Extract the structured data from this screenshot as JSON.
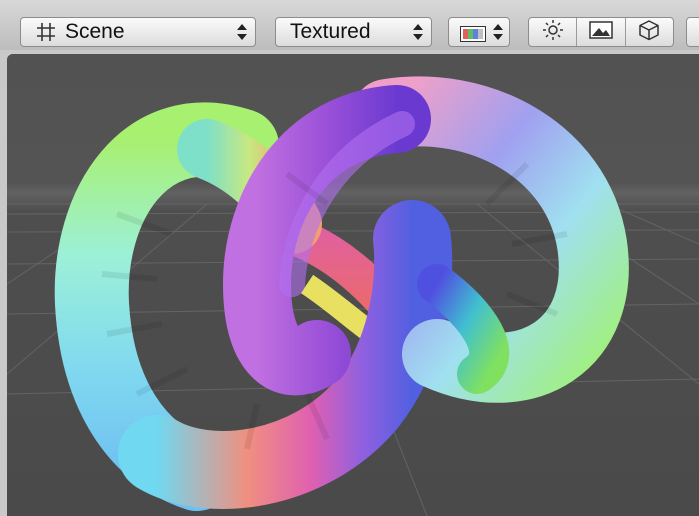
{
  "toolbar": {
    "draw_mode": {
      "label": "Scene",
      "icon": "hash-grid-icon"
    },
    "shading_mode": {
      "label": "Textured"
    },
    "render_paths": {
      "icon": "color-channels-icon"
    },
    "toggles": [
      {
        "icon": "sun-icon"
      },
      {
        "icon": "image-icon"
      },
      {
        "icon": "cube-icon"
      }
    ]
  },
  "viewport": {
    "background": "#505050",
    "grid_color": "#6a6a6a",
    "object": "torus-knot"
  }
}
